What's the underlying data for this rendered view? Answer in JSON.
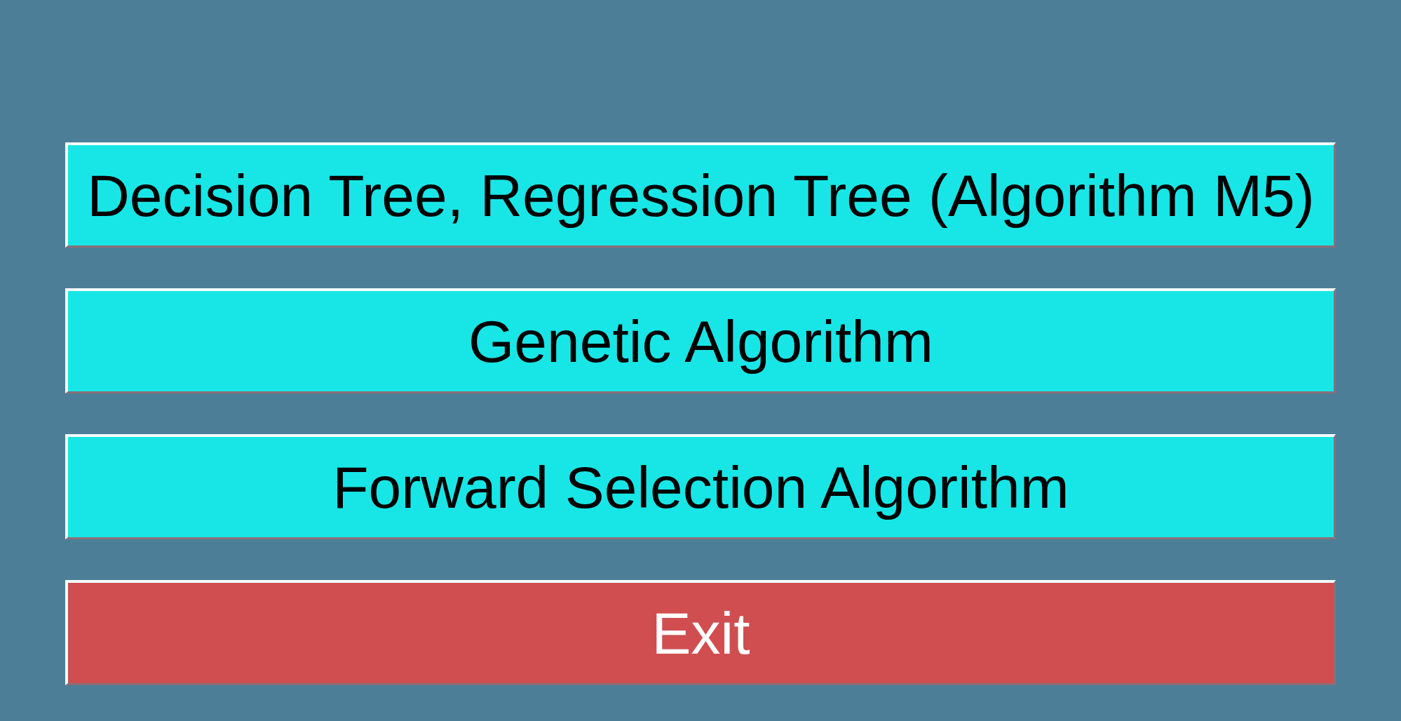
{
  "buttons": [
    {
      "label": "Decision Tree, Regression Tree (Algorithm M5)",
      "kind": "option",
      "color": "#18e6e6"
    },
    {
      "label": "Genetic Algorithm",
      "kind": "option",
      "color": "#18e6e6"
    },
    {
      "label": "Forward Selection Algorithm",
      "kind": "option",
      "color": "#18e6e6"
    },
    {
      "label": "Exit",
      "kind": "exit",
      "color": "#d04e50"
    }
  ]
}
